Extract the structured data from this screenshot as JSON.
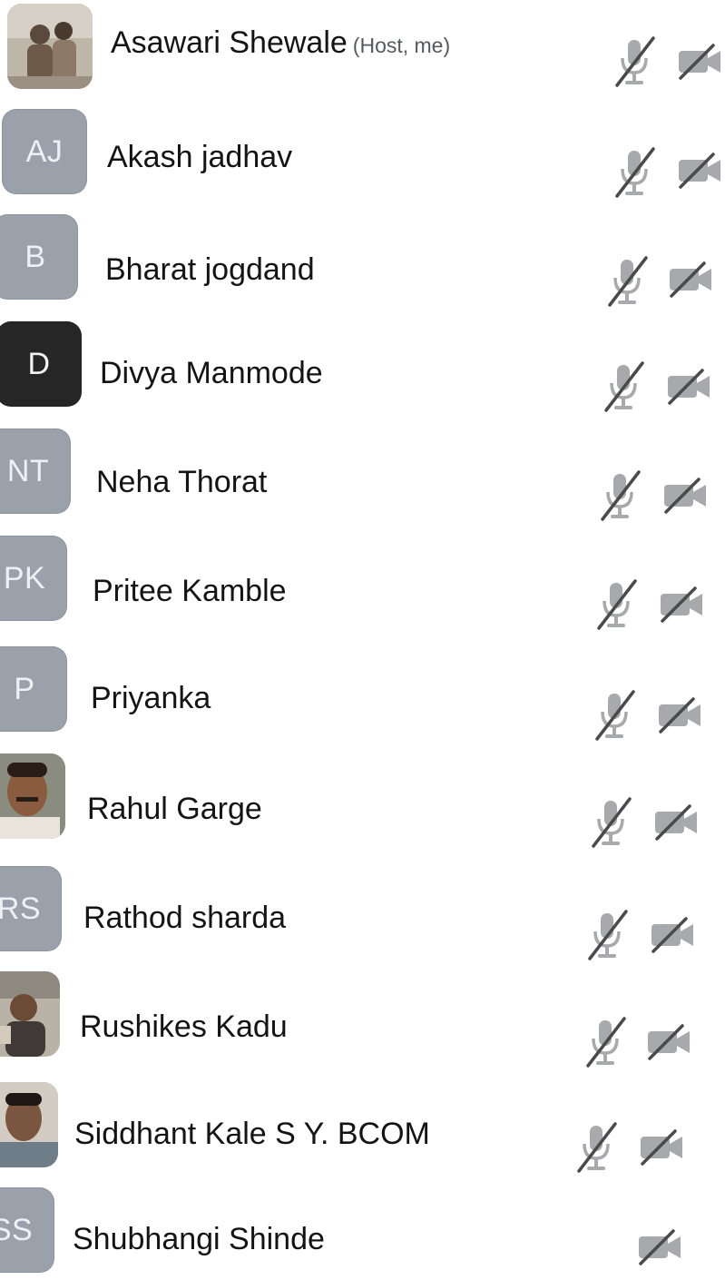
{
  "colors": {
    "initials_avatar": "#9aa1ab",
    "dark_avatar": "#262626",
    "muted_icon": "#a7a9ac",
    "text": "#141414"
  },
  "participants": [
    {
      "name": "Asawari Shewale",
      "tag": "(Host, me)",
      "avatar_type": "photo",
      "initials": "",
      "mic_muted": true,
      "video_off": true
    },
    {
      "name": "Akash jadhav",
      "tag": "",
      "avatar_type": "initials",
      "initials": "AJ",
      "mic_muted": true,
      "video_off": true
    },
    {
      "name": "Bharat  jogdand",
      "tag": "",
      "avatar_type": "initials",
      "initials": "B",
      "mic_muted": true,
      "video_off": true
    },
    {
      "name": "Divya Manmode",
      "tag": "",
      "avatar_type": "initials-dark",
      "initials": "D",
      "mic_muted": true,
      "video_off": true
    },
    {
      "name": "Neha Thorat",
      "tag": "",
      "avatar_type": "initials",
      "initials": "NT",
      "mic_muted": true,
      "video_off": true
    },
    {
      "name": "Pritee Kamble",
      "tag": "",
      "avatar_type": "initials",
      "initials": "PK",
      "mic_muted": true,
      "video_off": true
    },
    {
      "name": "Priyanka",
      "tag": "",
      "avatar_type": "initials",
      "initials": "P",
      "mic_muted": true,
      "video_off": true
    },
    {
      "name": "Rahul Garge",
      "tag": "",
      "avatar_type": "photo",
      "initials": "",
      "mic_muted": true,
      "video_off": true
    },
    {
      "name": "Rathod sharda",
      "tag": "",
      "avatar_type": "initials",
      "initials": "RS",
      "mic_muted": true,
      "video_off": true
    },
    {
      "name": "Rushikes Kadu",
      "tag": "",
      "avatar_type": "photo",
      "initials": "",
      "mic_muted": true,
      "video_off": true
    },
    {
      "name": "Siddhant Kale  S Y. BCOM",
      "tag": "",
      "avatar_type": "photo",
      "initials": "",
      "mic_muted": true,
      "video_off": true
    },
    {
      "name": "Shubhangi Shinde",
      "tag": "",
      "avatar_type": "initials",
      "initials": "SS",
      "mic_muted": false,
      "video_off": true
    }
  ]
}
